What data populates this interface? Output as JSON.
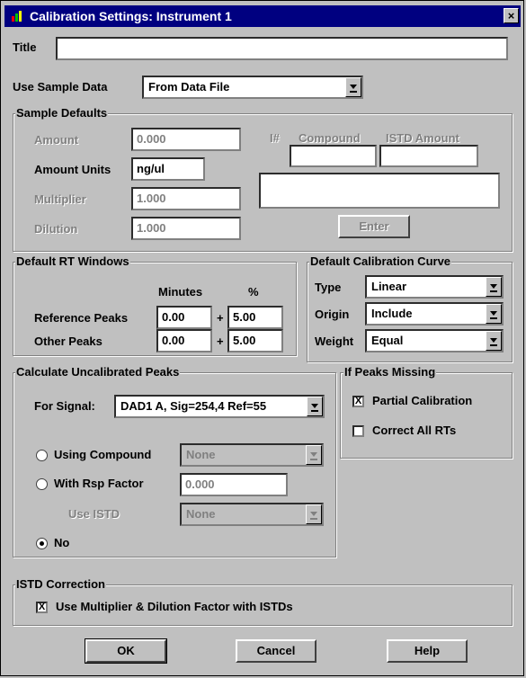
{
  "window": {
    "title": "Calibration Settings: Instrument 1",
    "close_label": "×"
  },
  "title_field": {
    "label": "Title",
    "value": ""
  },
  "use_sample_data": {
    "label": "Use Sample Data",
    "value": "From Data File"
  },
  "sample_defaults": {
    "legend": "Sample Defaults",
    "amount": {
      "label": "Amount",
      "value": "0.000"
    },
    "amount_units": {
      "label": "Amount Units",
      "value": "ng/ul"
    },
    "multiplier": {
      "label": "Multiplier",
      "value": "1.000"
    },
    "dilution": {
      "label": "Dilution",
      "value": "1.000"
    },
    "istd": {
      "col_num": "I#",
      "col_compound": "Compound",
      "col_amount": "ISTD Amount",
      "compound_value": "",
      "amount_value": "",
      "enter_label": "Enter"
    }
  },
  "rt_windows": {
    "legend": "Default RT Windows",
    "col_minutes": "Minutes",
    "col_percent": "%",
    "reference": {
      "label": "Reference Peaks",
      "minutes": "0.00",
      "plus": "+",
      "percent": "5.00"
    },
    "other": {
      "label": "Other Peaks",
      "minutes": "0.00",
      "plus": "+",
      "percent": "5.00"
    }
  },
  "calibration_curve": {
    "legend": "Default Calibration Curve",
    "type": {
      "label": "Type",
      "value": "Linear"
    },
    "origin": {
      "label": "Origin",
      "value": "Include"
    },
    "weight": {
      "label": "Weight",
      "value": "Equal"
    }
  },
  "uncalibrated": {
    "legend": "Calculate Uncalibrated Peaks",
    "signal": {
      "label": "For Signal:",
      "value": "DAD1 A, Sig=254,4 Ref=55"
    },
    "using_compound": {
      "label": "Using Compound",
      "value": "None"
    },
    "rsp_factor": {
      "label": "With Rsp Factor",
      "value": "0.000"
    },
    "use_istd": {
      "label": "Use ISTD",
      "value": "None"
    },
    "no": {
      "label": "No"
    }
  },
  "peaks_missing": {
    "legend": "If Peaks Missing",
    "partial": {
      "label": "Partial Calibration",
      "mark": "X"
    },
    "correct": {
      "label": "Correct All RTs",
      "mark": ""
    }
  },
  "istd_correction": {
    "legend": "ISTD Correction",
    "multiplier": {
      "label": "Use Multiplier & Dilution Factor with ISTDs",
      "mark": "X"
    }
  },
  "buttons": {
    "ok": "OK",
    "cancel": "Cancel",
    "help": "Help"
  }
}
